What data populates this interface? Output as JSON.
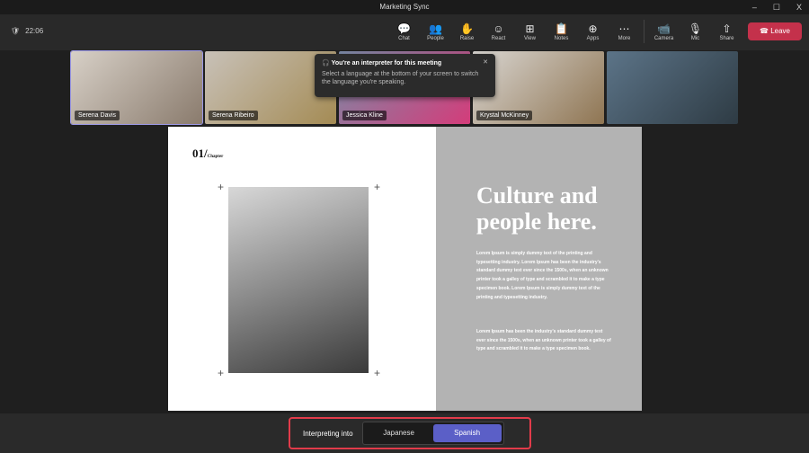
{
  "window": {
    "title": "Marketing Sync",
    "controls": [
      "–",
      "☐",
      "X"
    ]
  },
  "toolbar": {
    "time": "22:06",
    "tools": [
      {
        "label": "Chat",
        "icon": "💬"
      },
      {
        "label": "People",
        "icon": "👥"
      },
      {
        "label": "Raise",
        "icon": "✋"
      },
      {
        "label": "React",
        "icon": "☺"
      },
      {
        "label": "View",
        "icon": "⊞"
      },
      {
        "label": "Notes",
        "icon": "📋"
      },
      {
        "label": "Apps",
        "icon": "⊕"
      },
      {
        "label": "More",
        "icon": "⋯"
      }
    ],
    "media": [
      {
        "label": "Camera",
        "icon": "📹"
      },
      {
        "label": "Mic",
        "icon": "🎙"
      },
      {
        "label": "Share",
        "icon": "⇧"
      }
    ],
    "leave": "Leave"
  },
  "participants": [
    "Serena Davis",
    "Serena Ribeiro",
    "Jessica Kline",
    "Krystal McKinney",
    ""
  ],
  "tooltip": {
    "title": "You're an interpreter for this meeting",
    "body": "Select a language at the bottom of your screen to switch the language you're speaking."
  },
  "slide": {
    "number": "01",
    "chapter": "Chapter",
    "heading": "Culture and people here.",
    "para1": "Lorem Ipsum is simply dummy text of the printing and typesetting industry. Lorem Ipsum has been the industry's standard dummy text ever since the 1500s, when an unknown printer took a galley of type and scrambled it to make a type specimen book. Lorem Ipsum is simply dummy text of the printing and typesetting industry.",
    "para2": "Lorem Ipsum has been the industry's standard dummy text ever since the 1500s, when an unknown printer took a galley of type and scrambled it to make a type specimen book."
  },
  "interpreting": {
    "label": "Interpreting into",
    "options": [
      "Japanese",
      "Spanish"
    ],
    "selected": "Spanish"
  },
  "colors": {
    "accent": "#5b5fc7",
    "leave": "#c4314b",
    "highlight": "#e23b4a"
  }
}
